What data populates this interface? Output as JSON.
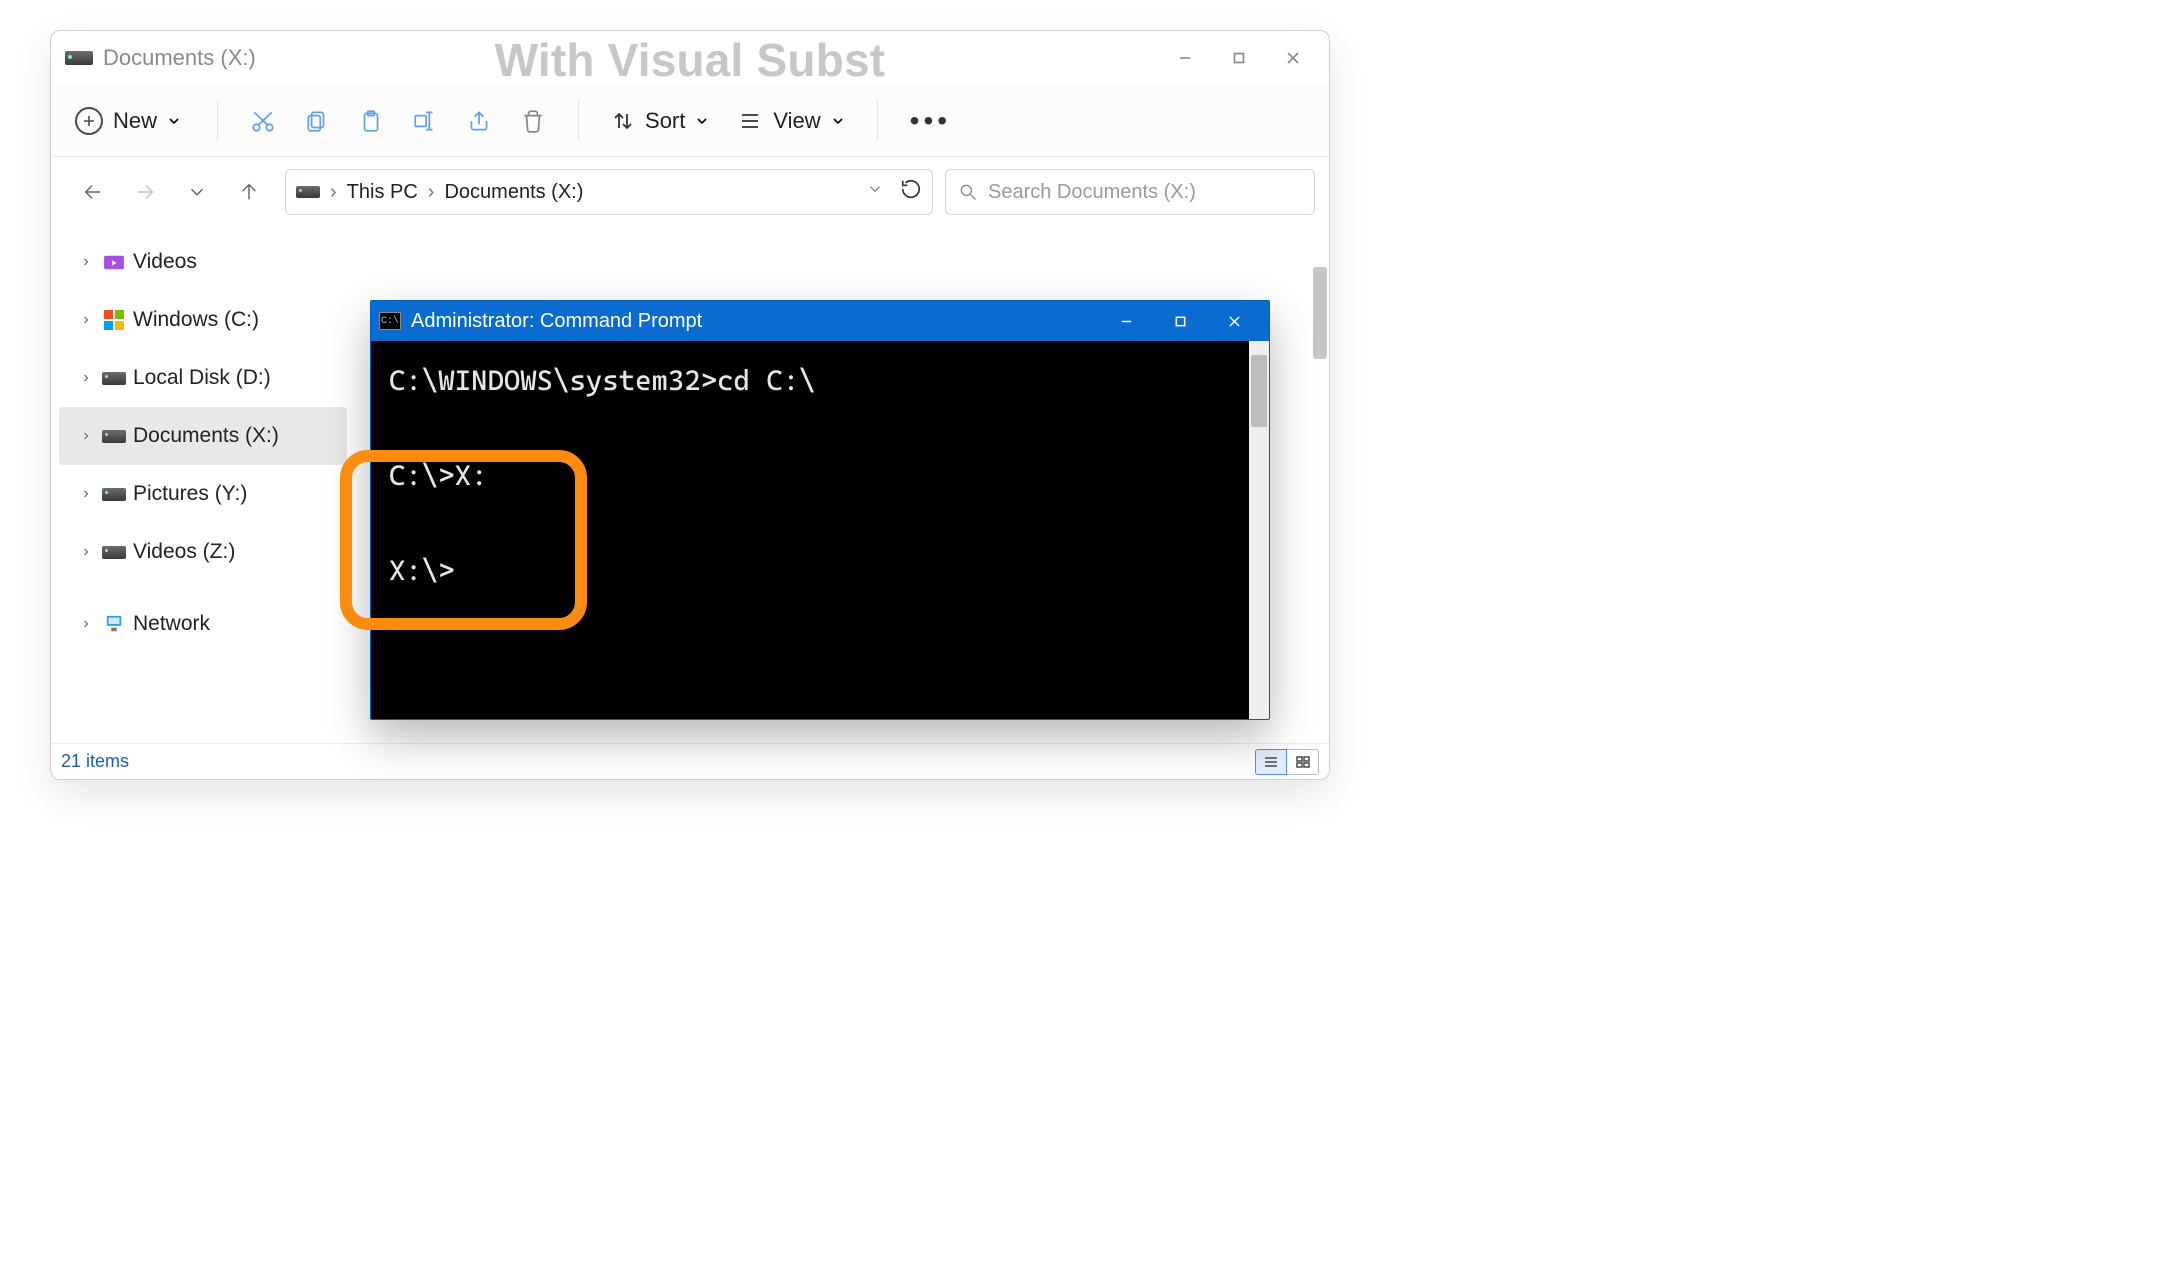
{
  "overlay_text": "With Visual Subst",
  "explorer": {
    "title": "Documents (X:)",
    "toolbar": {
      "new_label": "New",
      "sort_label": "Sort",
      "view_label": "View"
    },
    "breadcrumb": {
      "root": "This PC",
      "current": "Documents (X:)"
    },
    "search_placeholder": "Search Documents (X:)",
    "tree": [
      {
        "label": "Videos",
        "icon": "folder-videos",
        "selected": false
      },
      {
        "label": "Windows (C:)",
        "icon": "drive-windows",
        "selected": false
      },
      {
        "label": "Local Disk (D:)",
        "icon": "drive",
        "selected": false
      },
      {
        "label": "Documents (X:)",
        "icon": "drive",
        "selected": true
      },
      {
        "label": "Pictures (Y:)",
        "icon": "drive",
        "selected": false
      },
      {
        "label": "Videos (Z:)",
        "icon": "drive",
        "selected": false
      },
      {
        "label": "Network",
        "icon": "network",
        "selected": false
      }
    ],
    "status": "21 items"
  },
  "cmd": {
    "title": "Administrator: Command Prompt",
    "lines": [
      "C:\\WINDOWS\\system32>cd C:\\",
      "",
      "C:\\>X:",
      "",
      "X:\\>"
    ]
  }
}
